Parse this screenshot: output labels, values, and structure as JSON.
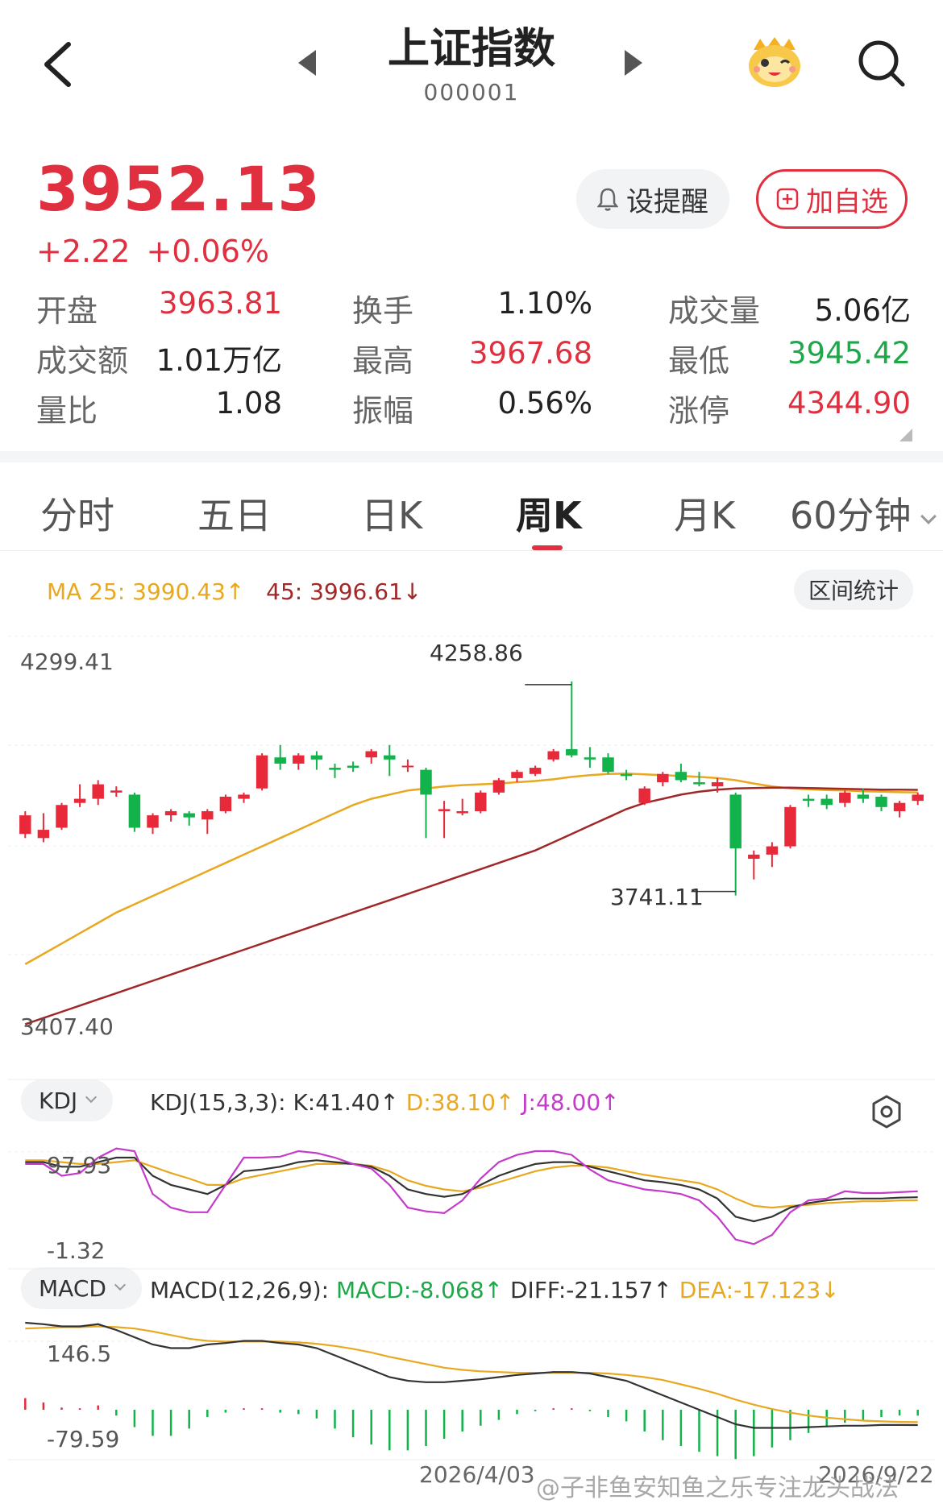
{
  "header": {
    "title": "上证指数",
    "code": "000001"
  },
  "quote": {
    "price": "3952.13",
    "change": "+2.22",
    "change_pct": "+0.06%",
    "remind_label": "设提醒",
    "add_label": "加自选"
  },
  "stats": [
    [
      {
        "label": "开盘",
        "value": "3963.81",
        "color": "red"
      },
      {
        "label": "换手",
        "value": "1.10%",
        "color": "dark"
      },
      {
        "label": "成交量",
        "value": "5.06亿",
        "color": "dark"
      }
    ],
    [
      {
        "label": "成交额",
        "value": "1.01万亿",
        "color": "dark"
      },
      {
        "label": "最高",
        "value": "3967.68",
        "color": "red"
      },
      {
        "label": "最低",
        "value": "3945.42",
        "color": "green"
      }
    ],
    [
      {
        "label": "量比",
        "value": "1.08",
        "color": "dark"
      },
      {
        "label": "振幅",
        "value": "0.56%",
        "color": "dark"
      },
      {
        "label": "涨停",
        "value": "4344.90",
        "color": "red"
      }
    ]
  ],
  "tabs": [
    "分时",
    "五日",
    "日K",
    "周K",
    "月K",
    "60分钟"
  ],
  "active_tab": "周K",
  "ma": {
    "ma25_label": "MA 25: 3990.43↑",
    "ma45_label": "45: 3996.61↓",
    "ma25_color": "#e8a820",
    "ma45_color": "#a02828"
  },
  "range_button": "区间统计",
  "colors": {
    "up": "#e8293a",
    "down": "#12b34a",
    "accent": "#e03040"
  },
  "kdj": {
    "selector": "KDJ",
    "params": "KDJ(15,3,3):",
    "k": "K:41.40↑",
    "d": "D:38.10↑",
    "j": "J:48.00↑",
    "axis_top": "97.93",
    "axis_bottom": "-1.32"
  },
  "macd": {
    "selector": "MACD",
    "params": "MACD(12,26,9):",
    "macd": "MACD:-8.068↑",
    "diff": "DIFF:-21.157↑",
    "dea": "DEA:-17.123↓",
    "axis_top": "146.5",
    "axis_bottom": "-79.59"
  },
  "icons": [
    "back-icon",
    "prev-icon",
    "next-icon",
    "mascot-icon",
    "search-icon",
    "bell-icon",
    "plus-square-icon",
    "gear-icon"
  ],
  "chart_data": {
    "type": "candlestick",
    "price_axis": {
      "top": "4299.41",
      "bottom": "3407.40",
      "min": 3407.4,
      "max": 4299.41
    },
    "annotations": [
      {
        "label": "4258.86",
        "kind": "high"
      },
      {
        "label": "3741.11",
        "kind": "low"
      }
    ],
    "dates": [
      "2026/4/03",
      "2026/9/22"
    ],
    "candles": [
      {
        "o": 3890,
        "c": 3935,
        "h": 3945,
        "l": 3880
      },
      {
        "o": 3880,
        "c": 3900,
        "h": 3940,
        "l": 3870
      },
      {
        "o": 3905,
        "c": 3960,
        "h": 3965,
        "l": 3900
      },
      {
        "o": 3965,
        "c": 3975,
        "h": 4010,
        "l": 3955
      },
      {
        "o": 3975,
        "c": 4010,
        "h": 4020,
        "l": 3960
      },
      {
        "o": 3990,
        "c": 3995,
        "h": 4005,
        "l": 3980
      },
      {
        "o": 3985,
        "c": 3905,
        "h": 3990,
        "l": 3895
      },
      {
        "o": 3905,
        "c": 3935,
        "h": 3940,
        "l": 3890
      },
      {
        "o": 3935,
        "c": 3945,
        "h": 3950,
        "l": 3920
      },
      {
        "o": 3940,
        "c": 3930,
        "h": 3945,
        "l": 3910
      },
      {
        "o": 3925,
        "c": 3945,
        "h": 3950,
        "l": 3890
      },
      {
        "o": 3945,
        "c": 3980,
        "h": 3985,
        "l": 3940
      },
      {
        "o": 3975,
        "c": 3985,
        "h": 3990,
        "l": 3965
      },
      {
        "o": 4000,
        "c": 4080,
        "h": 4085,
        "l": 3995
      },
      {
        "o": 4075,
        "c": 4060,
        "h": 4105,
        "l": 4045
      },
      {
        "o": 4060,
        "c": 4080,
        "h": 4085,
        "l": 4045
      },
      {
        "o": 4080,
        "c": 4070,
        "h": 4090,
        "l": 4045
      },
      {
        "o": 4050,
        "c": 4045,
        "h": 4060,
        "l": 4025
      },
      {
        "o": 4055,
        "c": 4050,
        "h": 4065,
        "l": 4040
      },
      {
        "o": 4075,
        "c": 4090,
        "h": 4095,
        "l": 4060
      },
      {
        "o": 4080,
        "c": 4070,
        "h": 4105,
        "l": 4030
      },
      {
        "o": 4055,
        "c": 4055,
        "h": 4070,
        "l": 4040
      },
      {
        "o": 4045,
        "c": 3985,
        "h": 4050,
        "l": 3880
      },
      {
        "o": 3945,
        "c": 3950,
        "h": 3970,
        "l": 3880
      },
      {
        "o": 3940,
        "c": 3945,
        "h": 3975,
        "l": 3935
      },
      {
        "o": 3945,
        "c": 3990,
        "h": 3995,
        "l": 3940
      },
      {
        "o": 3990,
        "c": 4020,
        "h": 4025,
        "l": 3985
      },
      {
        "o": 4025,
        "c": 4040,
        "h": 4045,
        "l": 4015
      },
      {
        "o": 4035,
        "c": 4050,
        "h": 4055,
        "l": 4030
      },
      {
        "o": 4070,
        "c": 4090,
        "h": 4095,
        "l": 4065
      },
      {
        "o": 4095,
        "c": 4080,
        "h": 4258.86,
        "l": 4075
      },
      {
        "o": 4075,
        "c": 4070,
        "h": 4100,
        "l": 4050
      },
      {
        "o": 4075,
        "c": 4040,
        "h": 4085,
        "l": 4035
      },
      {
        "o": 4035,
        "c": 4030,
        "h": 4045,
        "l": 4020
      },
      {
        "o": 3965,
        "c": 4000,
        "h": 4005,
        "l": 3960
      },
      {
        "o": 4015,
        "c": 4035,
        "h": 4040,
        "l": 4005
      },
      {
        "o": 4040,
        "c": 4020,
        "h": 4060,
        "l": 4015
      },
      {
        "o": 4015,
        "c": 4010,
        "h": 4040,
        "l": 4005
      },
      {
        "o": 4005,
        "c": 4015,
        "h": 4025,
        "l": 3990
      },
      {
        "o": 3985,
        "c": 3855,
        "h": 3990,
        "l": 3741.11
      },
      {
        "o": 3830,
        "c": 3840,
        "h": 3850,
        "l": 3780
      },
      {
        "o": 3840,
        "c": 3860,
        "h": 3870,
        "l": 3810
      },
      {
        "o": 3860,
        "c": 3955,
        "h": 3960,
        "l": 3855
      },
      {
        "o": 3975,
        "c": 3970,
        "h": 3985,
        "l": 3955
      },
      {
        "o": 3975,
        "c": 3960,
        "h": 3985,
        "l": 3950
      },
      {
        "o": 3965,
        "c": 3990,
        "h": 3995,
        "l": 3955
      },
      {
        "o": 3985,
        "c": 3975,
        "h": 4000,
        "l": 3965
      },
      {
        "o": 3980,
        "c": 3955,
        "h": 3985,
        "l": 3945
      },
      {
        "o": 3945,
        "c": 3965,
        "h": 3970,
        "l": 3930
      },
      {
        "o": 3970,
        "c": 3985,
        "h": 3990,
        "l": 3960
      }
    ],
    "ma25": [
      3575,
      3600,
      3625,
      3650,
      3675,
      3700,
      3720,
      3740,
      3760,
      3780,
      3800,
      3820,
      3840,
      3860,
      3880,
      3900,
      3920,
      3940,
      3960,
      3975,
      3985,
      3995,
      4000,
      4005,
      4008,
      4010,
      4012,
      4015,
      4018,
      4022,
      4028,
      4032,
      4035,
      4036,
      4034,
      4032,
      4030,
      4028,
      4025,
      4020,
      4012,
      4005,
      4000,
      3998,
      3996,
      3995,
      3993,
      3992,
      3991,
      3990.43
    ],
    "ma45": [
      3430,
      3445,
      3460,
      3475,
      3490,
      3505,
      3520,
      3535,
      3550,
      3565,
      3580,
      3595,
      3610,
      3625,
      3640,
      3655,
      3670,
      3685,
      3700,
      3715,
      3730,
      3745,
      3760,
      3775,
      3790,
      3805,
      3820,
      3835,
      3850,
      3870,
      3890,
      3910,
      3930,
      3950,
      3965,
      3975,
      3985,
      3992,
      3997,
      4000,
      4001,
      4002,
      4002,
      4001,
      4000,
      3999,
      3998,
      3997,
      3997,
      3996.61
    ],
    "kdj": {
      "k": [
        80,
        80,
        75,
        75,
        80,
        85,
        85,
        65,
        55,
        50,
        45,
        55,
        70,
        72,
        75,
        80,
        82,
        80,
        78,
        75,
        65,
        50,
        45,
        42,
        45,
        55,
        65,
        72,
        78,
        80,
        80,
        75,
        70,
        65,
        60,
        58,
        55,
        50,
        40,
        20,
        15,
        20,
        30,
        35,
        38,
        40,
        40,
        40,
        41,
        41.4
      ],
      "d": [
        82,
        82,
        80,
        78,
        78,
        80,
        82,
        75,
        68,
        62,
        55,
        55,
        62,
        66,
        70,
        74,
        78,
        78,
        78,
        76,
        70,
        60,
        54,
        50,
        48,
        52,
        58,
        64,
        70,
        74,
        76,
        76,
        74,
        70,
        66,
        63,
        60,
        57,
        50,
        40,
        32,
        30,
        32,
        33,
        35,
        36,
        37,
        37,
        38,
        38.1
      ],
      "j": [
        78,
        78,
        65,
        68,
        85,
        95,
        92,
        45,
        30,
        25,
        25,
        55,
        85,
        85,
        86,
        92,
        90,
        85,
        78,
        73,
        55,
        30,
        26,
        24,
        38,
        62,
        80,
        88,
        92,
        92,
        88,
        72,
        60,
        55,
        50,
        48,
        45,
        38,
        20,
        -5,
        -10,
        0,
        25,
        38,
        40,
        48,
        46,
        46,
        47,
        48
      ]
    },
    "macd": {
      "diff": [
        120,
        118,
        115,
        115,
        118,
        110,
        100,
        90,
        85,
        85,
        90,
        92,
        95,
        95,
        92,
        90,
        85,
        75,
        65,
        55,
        45,
        40,
        38,
        38,
        40,
        42,
        45,
        48,
        50,
        52,
        52,
        50,
        45,
        40,
        30,
        20,
        10,
        0,
        -10,
        -20,
        -25,
        -25,
        -25,
        -24,
        -23,
        -22,
        -22,
        -21,
        -21,
        -21.157
      ],
      "dea": [
        112,
        113,
        114,
        114,
        115,
        114,
        112,
        108,
        103,
        98,
        95,
        94,
        94,
        94,
        94,
        93,
        91,
        88,
        84,
        79,
        73,
        68,
        63,
        58,
        55,
        53,
        52,
        51,
        51,
        51,
        51,
        51,
        50,
        48,
        45,
        41,
        35,
        29,
        22,
        14,
        7,
        1,
        -4,
        -8,
        -11,
        -13,
        -15,
        -16,
        -16.8,
        -17.123
      ],
      "hist": [
        16,
        10,
        3,
        2,
        6,
        -8,
        -24,
        -36,
        -36,
        -26,
        -10,
        -4,
        2,
        2,
        -4,
        -6,
        -12,
        -26,
        -38,
        -48,
        -56,
        -56,
        -50,
        -40,
        -30,
        -22,
        -14,
        -6,
        -2,
        2,
        2,
        -2,
        -10,
        -16,
        -30,
        -42,
        -50,
        -58,
        -64,
        -68,
        -64,
        -52,
        -42,
        -32,
        -24,
        -18,
        -14,
        -10,
        -8,
        -8.068
      ]
    }
  },
  "watermark": "@子非鱼安知鱼之乐专注龙头战法"
}
